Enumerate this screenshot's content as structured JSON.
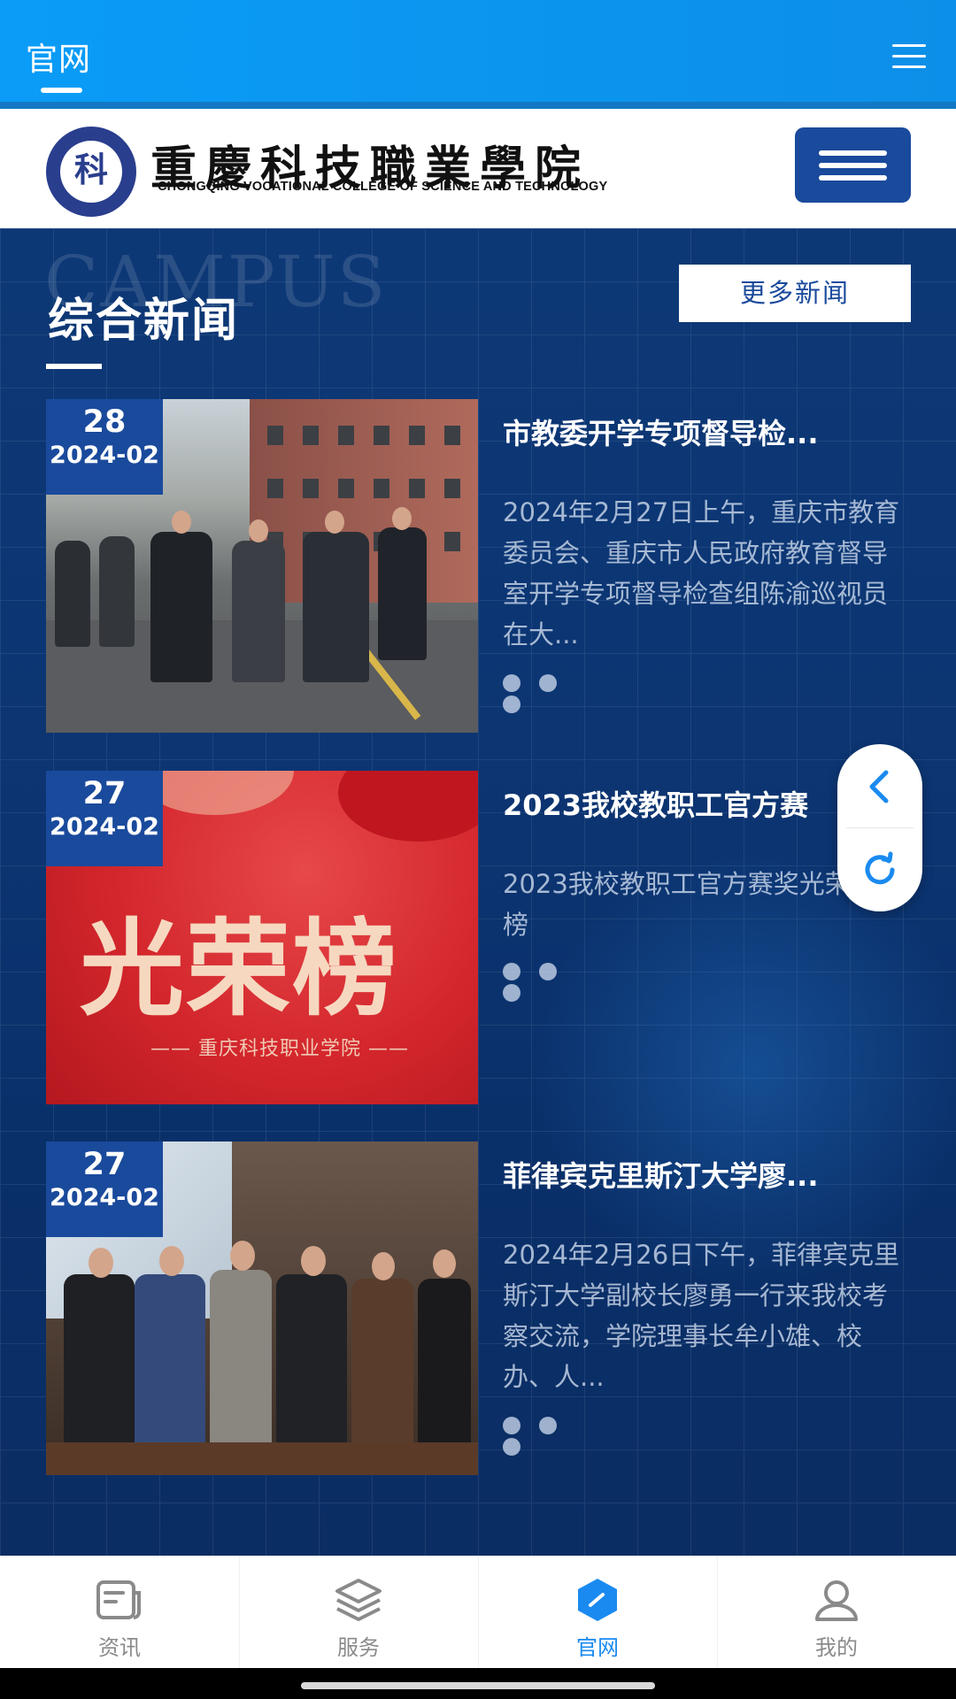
{
  "topbar": {
    "title": "官网"
  },
  "college": {
    "seal_text": "科",
    "name_cn": "重慶科技職業學院",
    "name_en": "CHONGQING VOCATIONAL COLLEGE OF SCIENCE AND TECHNOLOGY"
  },
  "section": {
    "watermark": "CAMPUS",
    "title": "综合新闻",
    "more_label": "更多新闻"
  },
  "news": [
    {
      "day": "28",
      "year_month": "2024-02",
      "title": "市教委开学专项督导检...",
      "summary": "2024年2月27日上午，重庆市教育委员会、重庆市人民政府教育督导室开学专项督导检查组陈渝巡视员在大..."
    },
    {
      "day": "27",
      "year_month": "2024-02",
      "title": "2023我校教职工官方赛",
      "summary": "2023我校教职工官方赛奖光荣榜",
      "image_text": "光荣榜",
      "image_subtext": "—— 重庆科技职业学院 ——"
    },
    {
      "day": "27",
      "year_month": "2024-02",
      "title": "菲律宾克里斯汀大学廖...",
      "summary": "2024年2月26日下午，菲律宾克里斯汀大学副校长廖勇一行来我校考察交流，学院理事长牟小雄、校办、人..."
    }
  ],
  "bottom_nav": [
    {
      "label": "资讯",
      "icon": "news-icon",
      "active": false
    },
    {
      "label": "服务",
      "icon": "layers-icon",
      "active": false
    },
    {
      "label": "官网",
      "icon": "website-icon",
      "active": true
    },
    {
      "label": "我的",
      "icon": "user-icon",
      "active": false
    }
  ],
  "colors": {
    "topbar": "#0a9cf7",
    "brand_blue": "#1a4a9c",
    "page_bg": "#0c3572",
    "active_nav": "#1a8af0"
  }
}
